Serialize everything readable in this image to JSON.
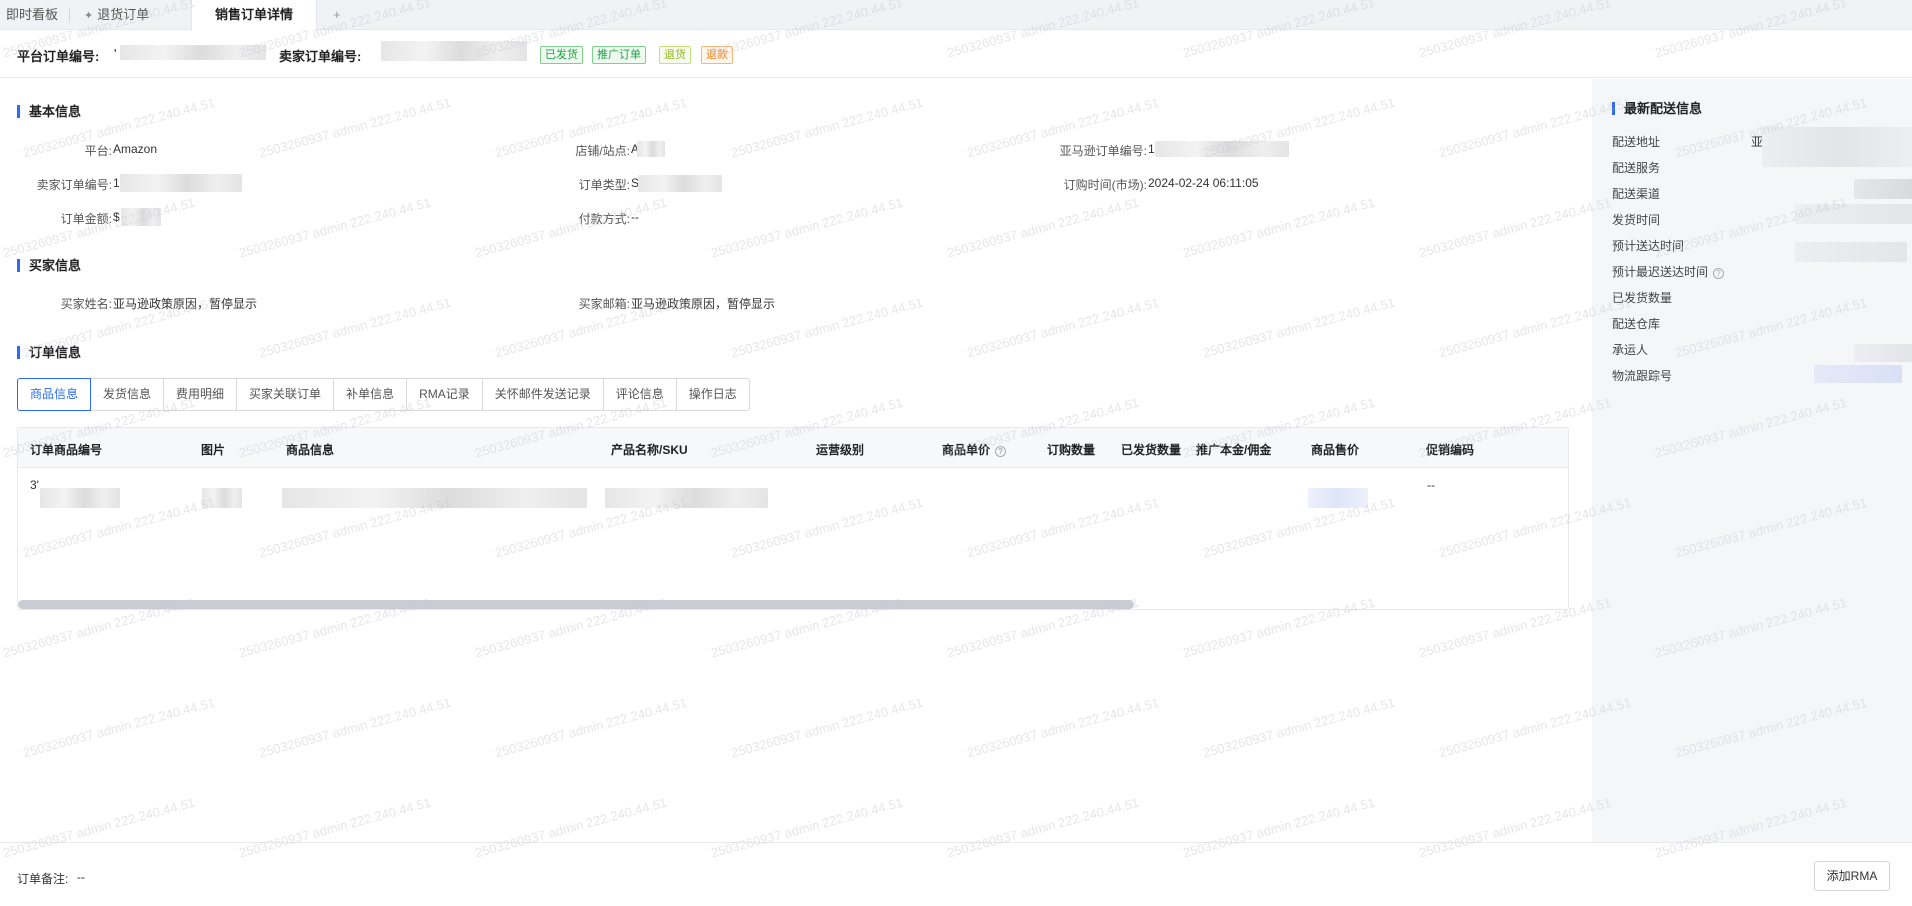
{
  "tabs": [
    {
      "label": "即时看板"
    },
    {
      "label": "退货订单"
    },
    {
      "label": "销售订单详情"
    },
    {
      "label": "+"
    }
  ],
  "header": {
    "platform_order_no_label": "平台订单编号:",
    "platform_order_no_value": "'",
    "seller_order_no_label": "卖家订单编号:",
    "tags": [
      "已发货",
      "推广订单",
      "退货",
      "退款"
    ]
  },
  "basic_info": {
    "title": "基本信息",
    "platform_label": "平台:",
    "platform_value": "Amazon",
    "store_label": "店铺/站点:",
    "store_value": "A",
    "amazon_order_label": "亚马逊订单编号:",
    "amazon_order_value": "1",
    "seller_order_label": "卖家订单编号:",
    "seller_order_value": "1",
    "order_type_label": "订单类型:",
    "order_type_value": "S",
    "purchase_time_label": "订购时间(市场):",
    "purchase_time_value": "2024-02-24 06:11:05",
    "amount_label": "订单金额:",
    "amount_value": "$",
    "payment_label": "付款方式:",
    "payment_value": "--"
  },
  "buyer_info": {
    "title": "买家信息",
    "name_label": "买家姓名:",
    "name_value": "亚马逊政策原因，暂停显示",
    "email_label": "买家邮箱:",
    "email_value": "亚马逊政策原因，暂停显示"
  },
  "order_info": {
    "title": "订单信息",
    "subtabs": [
      "商品信息",
      "发货信息",
      "费用明细",
      "买家关联订单",
      "补单信息",
      "RMA记录",
      "关怀邮件发送记录",
      "评论信息",
      "操作日志"
    ]
  },
  "table": {
    "columns": [
      "订单商品编号",
      "图片",
      "商品信息",
      "产品名称/SKU",
      "运营级别",
      "商品单价",
      "订购数量",
      "已发货数量",
      "推广本金/佣金",
      "商品售价",
      "促销编码"
    ],
    "row": {
      "item_no": "3'",
      "promo_code": "--"
    }
  },
  "delivery": {
    "title": "最新配送信息",
    "labels": [
      "配送地址",
      "配送服务",
      "配送渠道",
      "发货时间",
      "预计送达时间",
      "预计最迟送达时间",
      "已发货数量",
      "配送仓库",
      "承运人",
      "物流跟踪号"
    ],
    "address_value": "亚"
  },
  "footer": {
    "remark_label": "订单备注:",
    "remark_value": "--",
    "add_rma_label": "添加RMA"
  },
  "watermark": "2503260937 admin 222.240.44.51"
}
